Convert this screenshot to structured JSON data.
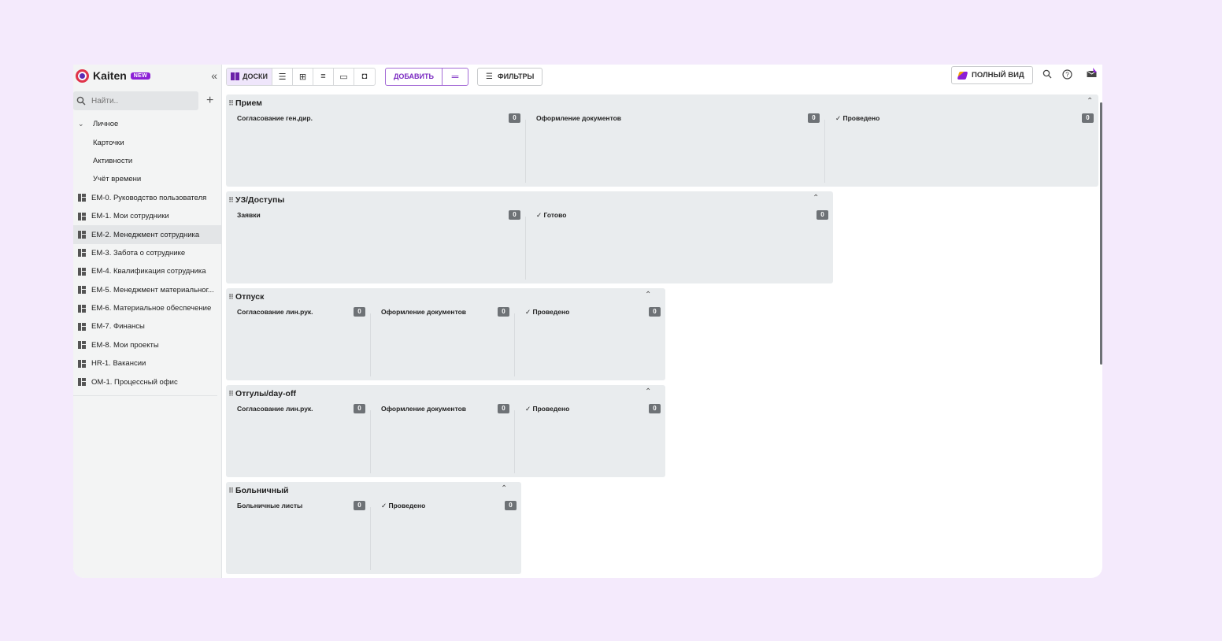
{
  "sidebar": {
    "app_name": "Kaiten",
    "new_badge": "NEW",
    "collapse_glyph": "«",
    "search_placeholder": "Найти..",
    "add_glyph": "+",
    "personal_label": "Личное",
    "personal_items": [
      "Карточки",
      "Активности",
      "Учёт времени"
    ],
    "boards": [
      "EM-0. Руководство пользователя",
      "EM-1. Мои сотрудники",
      "EM-2. Менеджмент сотрудника",
      "EM-3. Забота о сотруднике",
      "EM-4. Квалификация сотрудника",
      "EM-5. Менеджмент материальног...",
      "EM-6. Материальное обеспечение",
      "EM-7. Финансы",
      "EM-8. Мои проекты",
      "HR-1. Вакансии",
      "OM-1. Процессный офис"
    ],
    "active_board_index": 2
  },
  "toolbar": {
    "boards_label": "ДОСКИ",
    "add_label": "ДОБАВИТЬ",
    "filters_label": "ФИЛЬТРЫ",
    "full_view_label": "ПОЛНЫЙ ВИД"
  },
  "icons": {
    "search": "search-icon",
    "help": "help-icon",
    "notifications": "notification-icon"
  },
  "colors": {
    "accent": "#8c1fd6",
    "lane_bg": "#e9ecee",
    "page_bg": "#f4eafc"
  },
  "lanes": [
    {
      "title": "Прием",
      "columns": [
        {
          "title": "Согласование ген.дир.",
          "count": "0",
          "done": false
        },
        {
          "title": "Оформление документов",
          "count": "0",
          "done": false
        },
        {
          "title": "✓ Проведено",
          "count": "0",
          "done": true
        }
      ]
    },
    {
      "title": "УЗ/Доступы",
      "columns": [
        {
          "title": "Заявки",
          "count": "0",
          "done": false
        },
        {
          "title": "✓ Готово",
          "count": "0",
          "done": true
        }
      ]
    },
    {
      "title": "Отпуск",
      "columns": [
        {
          "title": "Согласование лин.рук.",
          "count": "0",
          "done": false
        },
        {
          "title": "Оформление документов",
          "count": "0",
          "done": false
        },
        {
          "title": "✓ Проведено",
          "count": "0",
          "done": true
        }
      ]
    },
    {
      "title": "Отгулы/day-off",
      "columns": [
        {
          "title": "Согласование лин.рук.",
          "count": "0",
          "done": false
        },
        {
          "title": "Оформление документов",
          "count": "0",
          "done": false
        },
        {
          "title": "✓ Проведено",
          "count": "0",
          "done": true
        }
      ]
    },
    {
      "title": "Больничный",
      "columns": [
        {
          "title": "Больничные листы",
          "count": "0",
          "done": false
        },
        {
          "title": "✓ Проведено",
          "count": "0",
          "done": true
        }
      ]
    }
  ]
}
